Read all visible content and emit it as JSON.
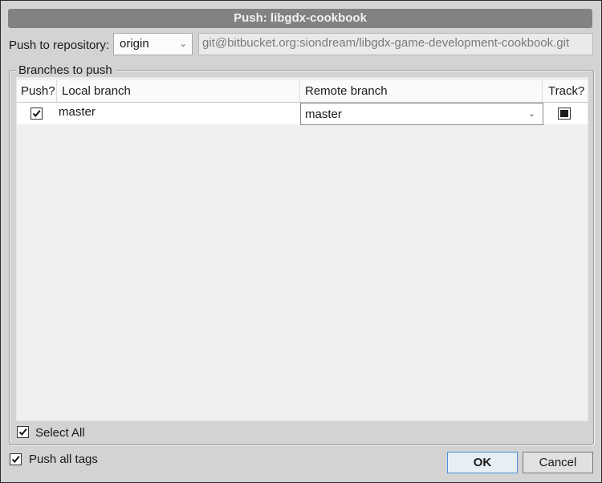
{
  "dialog": {
    "title": "Push: libgdx-cookbook"
  },
  "repository": {
    "label": "Push to repository:",
    "selected": "origin",
    "url": "git@bitbucket.org:siondream/libgdx-game-development-cookbook.git"
  },
  "branches": {
    "group_label": "Branches to push",
    "columns": [
      "Push?",
      "Local branch",
      "Remote branch",
      "Track?"
    ],
    "rows": [
      {
        "push": true,
        "local": "master",
        "remote": "master",
        "track": "indeterminate"
      }
    ],
    "select_all_label": "Select All",
    "select_all_checked": true
  },
  "options": {
    "push_all_tags_label": "Push all tags",
    "push_all_tags_checked": true
  },
  "buttons": {
    "ok": "OK",
    "cancel": "Cancel"
  }
}
